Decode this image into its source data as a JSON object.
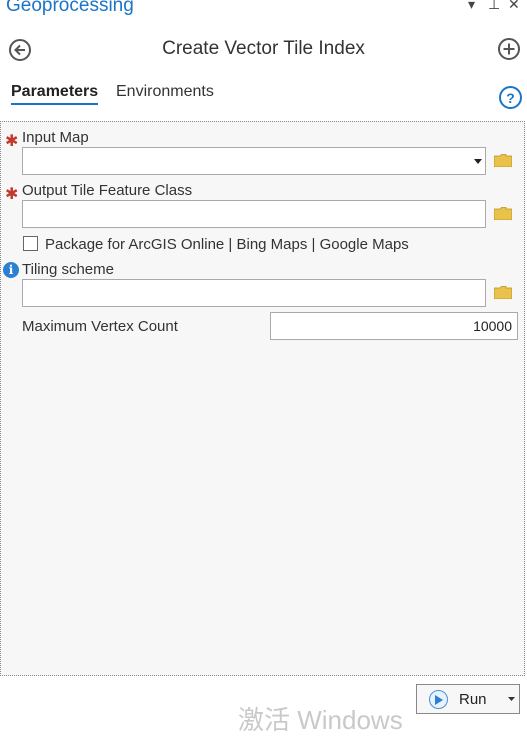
{
  "pane": {
    "title": "Geoprocessing",
    "menu_glyph": "▾",
    "pin_glyph": "⊥",
    "close_glyph": "✕"
  },
  "tool": {
    "title": "Create Vector Tile Index"
  },
  "tabs": [
    {
      "label": "Parameters",
      "active": true
    },
    {
      "label": "Environments",
      "active": false
    }
  ],
  "params": {
    "input_map": {
      "label": "Input Map",
      "value": "",
      "required": true
    },
    "output_tile": {
      "label": "Output Tile Feature Class",
      "value": "",
      "required": true
    },
    "package_checkbox": {
      "label": "Package for ArcGIS Online | Bing Maps | Google Maps",
      "checked": false
    },
    "tiling_scheme": {
      "label": "Tiling scheme",
      "value": ""
    },
    "max_vertex": {
      "label": "Maximum Vertex Count",
      "value": "10000"
    }
  },
  "footer": {
    "run_label": "Run",
    "watermark": "激活 Windows"
  },
  "colors": {
    "accent": "#1a75c7",
    "required": "#c0392b",
    "folder": "#e8c24a",
    "info": "#2d7fd1"
  },
  "icons": [
    "back-arrow-icon",
    "add-plus-icon",
    "help-icon",
    "folder-icon",
    "info-icon",
    "play-icon",
    "dropdown-arrow-icon"
  ]
}
